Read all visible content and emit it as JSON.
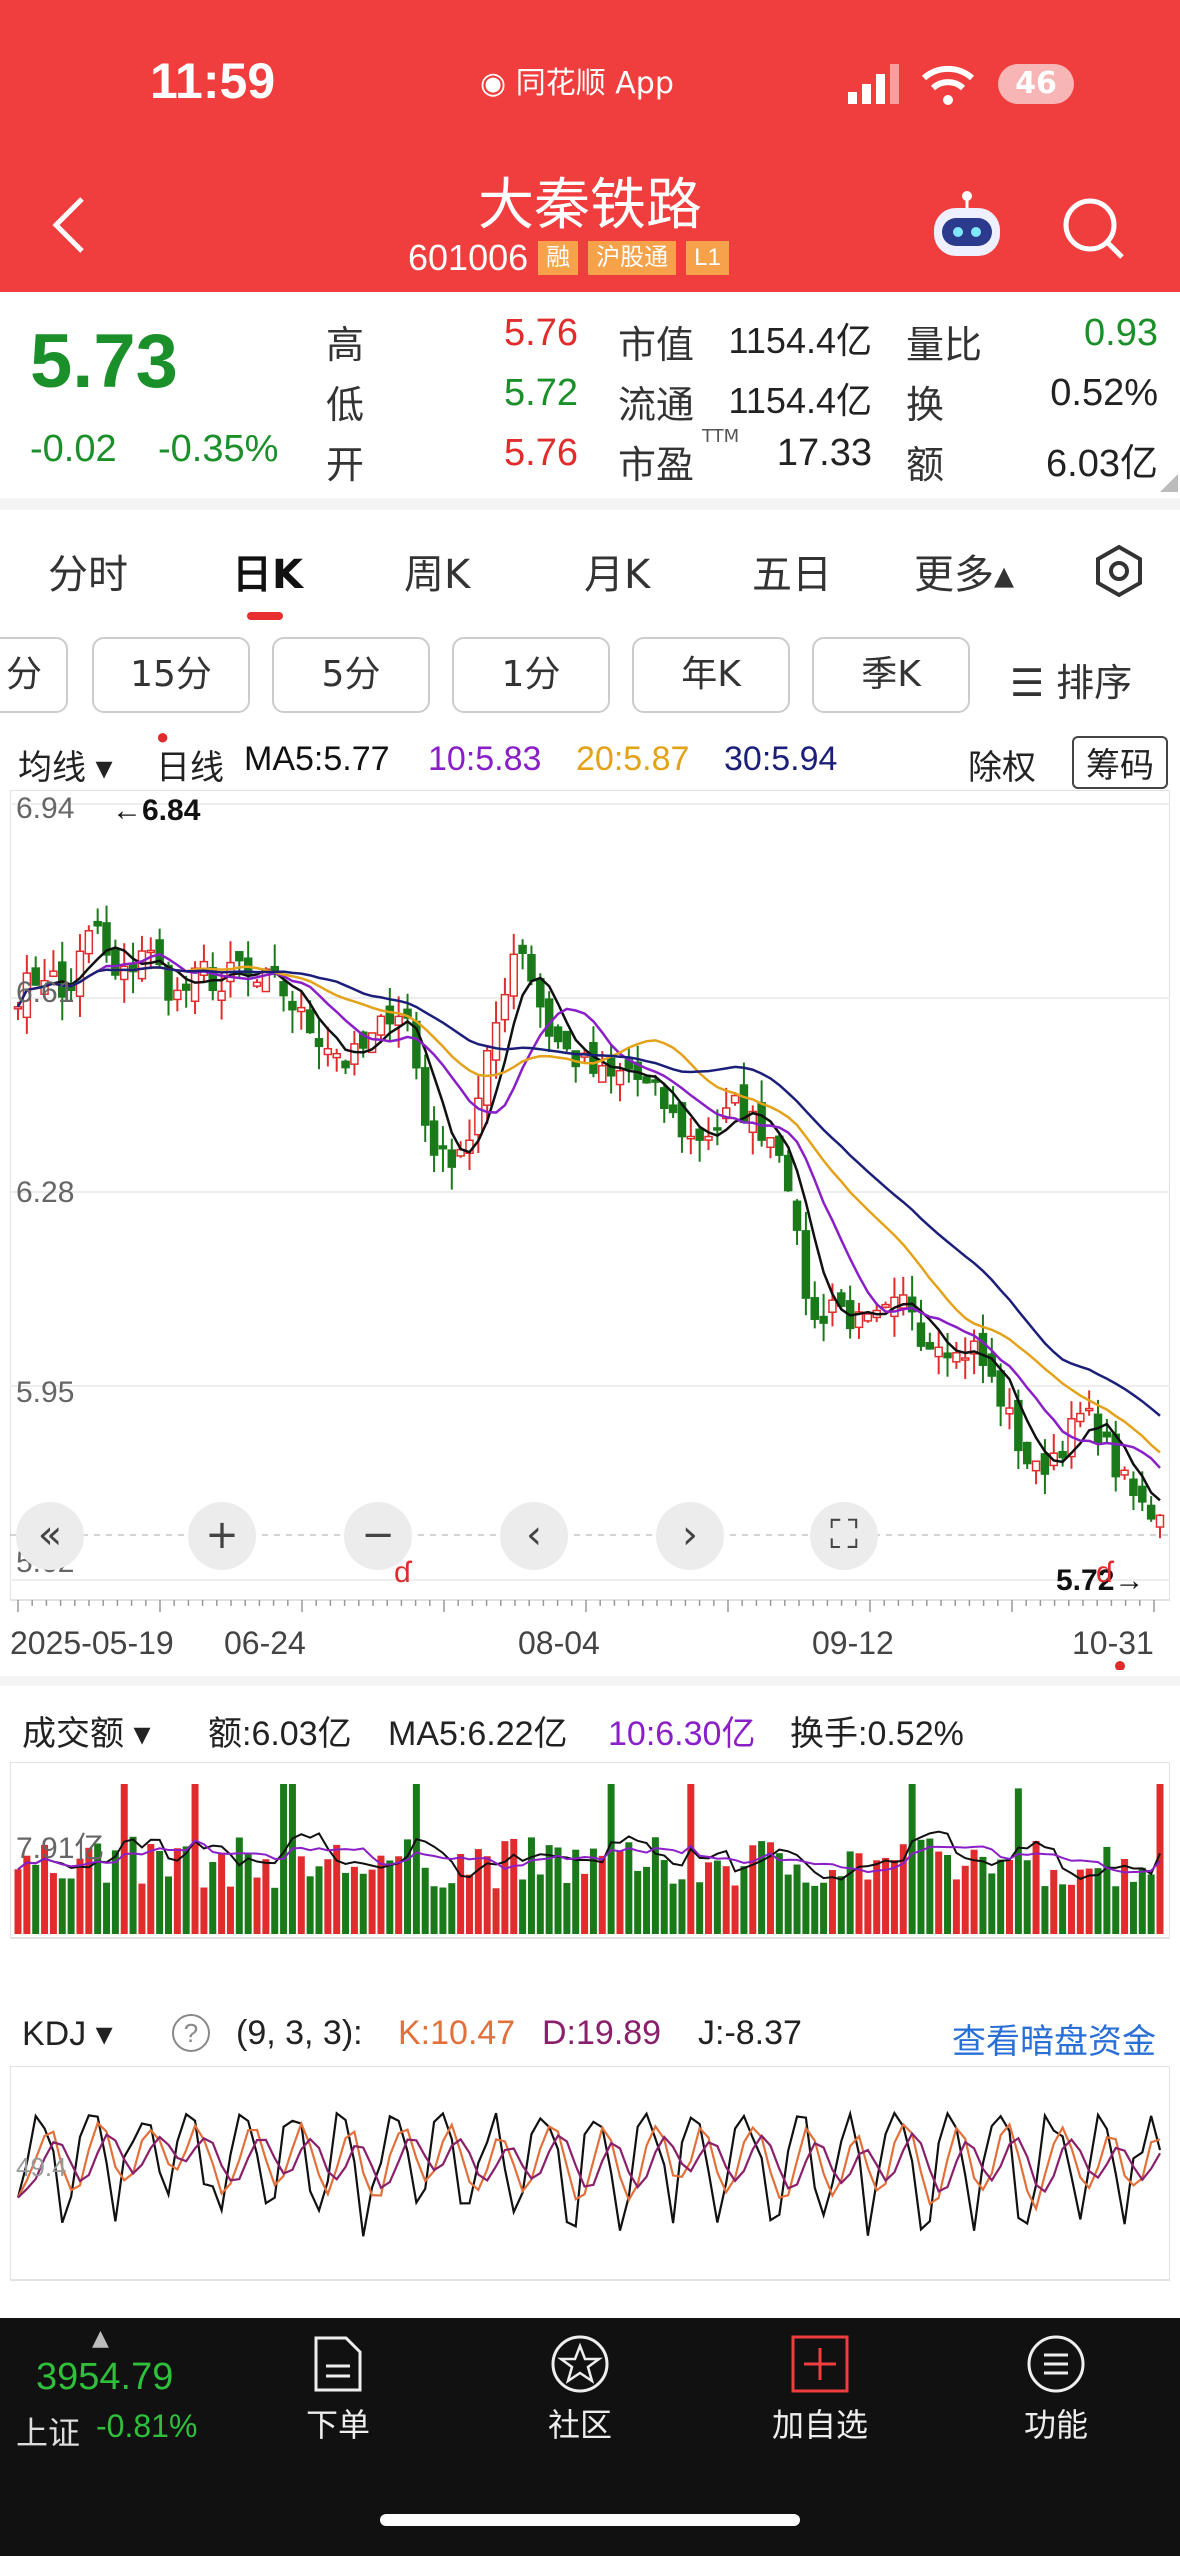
{
  "status": {
    "time": "11:59",
    "app": "同花顺 App",
    "battery": "46"
  },
  "header": {
    "title": "大秦铁路",
    "code": "601006",
    "tags": [
      "融",
      "沪股通",
      "L1"
    ]
  },
  "quote": {
    "price": "5.73",
    "change": "-0.02",
    "change_pct": "-0.35%",
    "rows": [
      {
        "l1": "高",
        "v1": "5.76",
        "l2": "市值",
        "v2": "1154.4亿",
        "l3": "量比",
        "v3": "0.93"
      },
      {
        "l1": "低",
        "v1": "5.72",
        "l2": "流通",
        "v2": "1154.4亿",
        "l3": "换",
        "v3": "0.52%"
      },
      {
        "l1": "开",
        "v1": "5.76",
        "l2": "市盈",
        "v2": "17.33",
        "l3": "额",
        "v3": "6.03亿"
      }
    ],
    "ttm": "TTM"
  },
  "period_tabs": [
    "分时",
    "日K",
    "周K",
    "月K",
    "五日",
    "更多▴"
  ],
  "minute_buttons": [
    "分",
    "15分",
    "5分",
    "1分",
    "年K",
    "季K"
  ],
  "sort_label": "☰ 排序",
  "indicator": {
    "ma_label": "均线 ▾",
    "period": "日线",
    "ma5": "MA5:5.77",
    "ma10": "10:5.83",
    "ma20": "20:5.87",
    "ma30": "30:5.94",
    "adjust": "除权",
    "chips": "筹码"
  },
  "colors": {
    "ma5": "#111111",
    "ma10": "#8a1fc7",
    "ma20": "#e3a21a",
    "ma30": "#1c1f7a",
    "up": "#e02c2c",
    "down": "#1a7a1a"
  },
  "kline": {
    "y_ticks": [
      "6.94",
      "6.61",
      "6.28",
      "5.95",
      "5.62"
    ],
    "high_marker": "←6.84",
    "low_marker": "5.72→",
    "x_ticks": [
      "2025-05-19",
      "06-24",
      "08-04",
      "09-12",
      "10-31"
    ]
  },
  "nav_buttons": [
    "«",
    "+",
    "−",
    "‹",
    "›",
    "⛶"
  ],
  "volume": {
    "label": "成交额 ▾",
    "amount": "额:6.03亿",
    "ma5": "MA5:6.22亿",
    "ma10": "10:6.30亿",
    "turnover": "换手:0.52%",
    "y_tick": "7.91亿"
  },
  "kdj": {
    "label": "KDJ ▾",
    "help": "?",
    "params": "(9, 3, 3):",
    "k": "K:10.47",
    "d": "D:19.89",
    "j": "J:-8.37",
    "link": "查看暗盘资金",
    "y_tick": "49.4"
  },
  "bottom": {
    "index_value": "3954.79",
    "index_name": "上证",
    "index_change": "-0.81%",
    "nav": [
      "下单",
      "社区",
      "加自选",
      "功能"
    ]
  },
  "chart_data": {
    "type": "candlestick",
    "title": "大秦铁路 601006 日K",
    "x_range": [
      "2025-05-19",
      "2025-10-31"
    ],
    "x_ticks": [
      "2025-05-19",
      "06-24",
      "08-04",
      "09-12",
      "10-31"
    ],
    "ylim": [
      5.62,
      6.94
    ],
    "y_ticks": [
      6.94,
      6.61,
      6.28,
      5.95,
      5.62
    ],
    "period_high": 6.84,
    "period_low": 5.72,
    "close_path": [
      6.62,
      6.64,
      6.66,
      6.6,
      6.68,
      6.74,
      6.64,
      6.65,
      6.7,
      6.66,
      6.61,
      6.63,
      6.66,
      6.62,
      6.67,
      6.63,
      6.64,
      6.62,
      6.58,
      6.55,
      6.53,
      6.5,
      6.52,
      6.55,
      6.6,
      6.57,
      6.4,
      6.33,
      6.35,
      6.38,
      6.5,
      6.62,
      6.72,
      6.63,
      6.55,
      6.52,
      6.5,
      6.48,
      6.47,
      6.49,
      6.46,
      6.44,
      6.4,
      6.37,
      6.38,
      6.4,
      6.43,
      6.4,
      6.38,
      6.35,
      6.15,
      6.05,
      6.1,
      6.07,
      6.05,
      6.06,
      6.08,
      6.1,
      6.02,
      6.04,
      6.0,
      6.02,
      5.97,
      5.92,
      5.85,
      5.8,
      5.83,
      5.86,
      5.9,
      5.88,
      5.82,
      5.77,
      5.74,
      5.73
    ],
    "ma": {
      "MA5": 5.77,
      "MA10": 5.83,
      "MA20": 5.87,
      "MA30": 5.94
    },
    "volume_ma": {
      "MA5": "6.22亿",
      "MA10": "6.30亿"
    },
    "kdj": {
      "K": 10.47,
      "D": 19.89,
      "J": -8.37
    }
  }
}
